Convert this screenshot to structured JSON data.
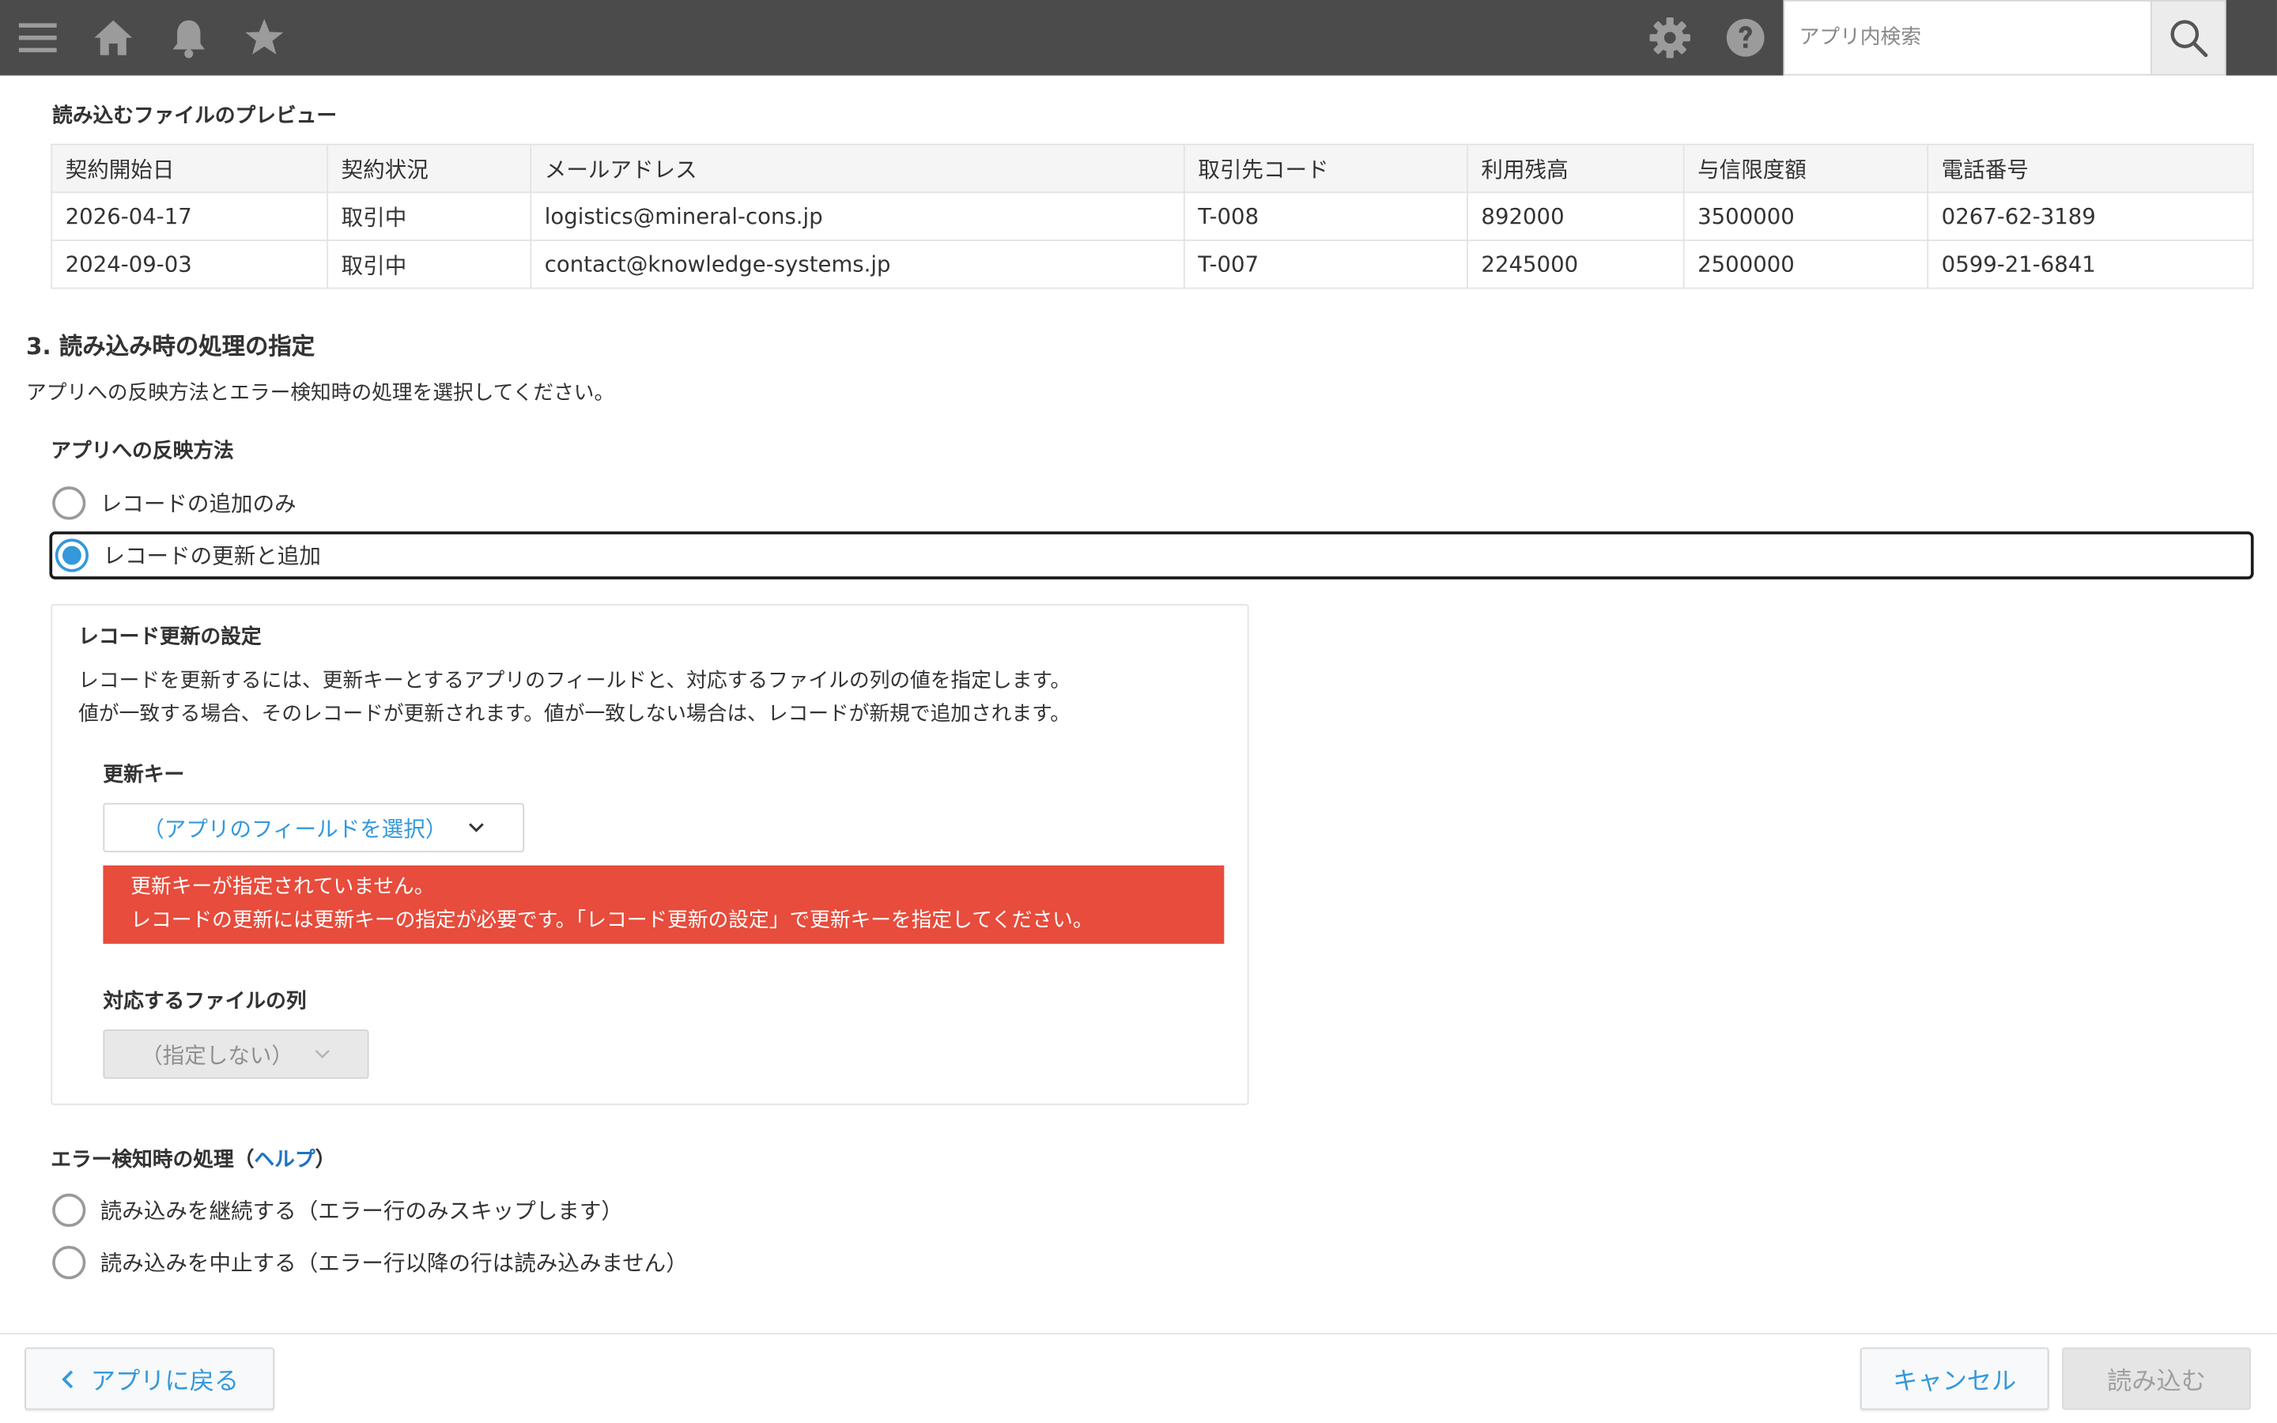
{
  "topbar": {
    "search_placeholder": "アプリ内検索"
  },
  "preview": {
    "title": "読み込むファイルのプレビュー",
    "columns": [
      "契約開始日",
      "契約状況",
      "メールアドレス",
      "取引先コード",
      "利用残高",
      "与信限度額",
      "電話番号"
    ],
    "rows": [
      [
        "2026-04-17",
        "取引中",
        "logistics@mineral-cons.jp",
        "T-008",
        "892000",
        "3500000",
        "0267-62-3189"
      ],
      [
        "2024-09-03",
        "取引中",
        "contact@knowledge-systems.jp",
        "T-007",
        "2245000",
        "2500000",
        "0599-21-6841"
      ]
    ]
  },
  "section": {
    "title": "3. 読み込み時の処理の指定",
    "desc": "アプリへの反映方法とエラー検知時の処理を選択してください。"
  },
  "reflect": {
    "title": "アプリへの反映方法",
    "options": [
      "レコードの追加のみ",
      "レコードの更新と追加"
    ],
    "selected": 1
  },
  "update_settings": {
    "title": "レコード更新の設定",
    "desc_line1": "レコードを更新するには、更新キーとするアプリのフィールドと、対応するファイルの列の値を指定します。",
    "desc_line2": "値が一致する場合、そのレコードが更新されます。値が一致しない場合は、レコードが新規で追加されます。",
    "key_label": "更新キー",
    "key_placeholder": "（アプリのフィールドを選択）",
    "error_line1": "更新キーが指定されていません。",
    "error_line2": "レコードの更新には更新キーの指定が必要です。「レコード更新の設定」で更新キーを指定してください。",
    "column_label": "対応するファイルの列",
    "column_value": "（指定しない）"
  },
  "error_handling": {
    "title_prefix": "エラー検知時の処理（",
    "help": "ヘルプ",
    "title_suffix": "）",
    "options": [
      "読み込みを継続する（エラー行のみスキップします）",
      "読み込みを中止する（エラー行以降の行は読み込みません）"
    ]
  },
  "footer": {
    "back": "アプリに戻る",
    "cancel": "キャンセル",
    "import": "読み込む"
  },
  "colors": {
    "topbar": "#4b4b4b",
    "accent": "#3498db",
    "error": "#e74c3c",
    "link": "#1f73c1"
  }
}
